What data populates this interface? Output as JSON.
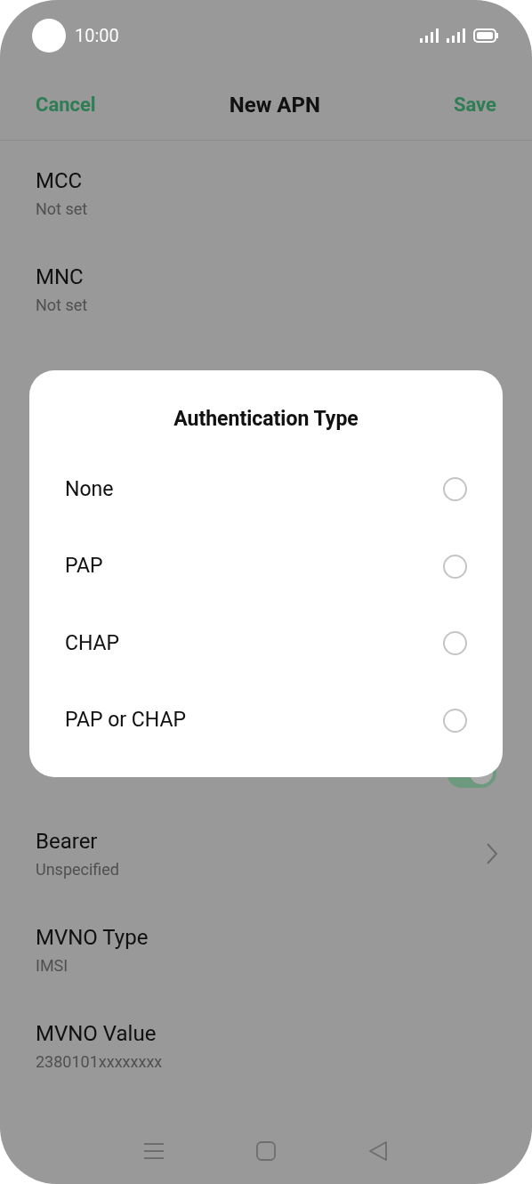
{
  "status_bar": {
    "time": "10:00"
  },
  "header": {
    "cancel": "Cancel",
    "title": "New APN",
    "save": "Save"
  },
  "fields_top": [
    {
      "label": "MCC",
      "value": "Not set"
    },
    {
      "label": "MNC",
      "value": "Not set"
    }
  ],
  "enable_toggle": {
    "on": true
  },
  "fields_bottom": [
    {
      "label": "Bearer",
      "value": "Unspecified",
      "chevron": true
    },
    {
      "label": "MVNO Type",
      "value": "IMSI",
      "chevron": false
    },
    {
      "label": "MVNO Value",
      "value": "2380101xxxxxxxx",
      "chevron": false
    }
  ],
  "dialog": {
    "title": "Authentication Type",
    "options": [
      {
        "label": "None",
        "selected": false
      },
      {
        "label": "PAP",
        "selected": false
      },
      {
        "label": "CHAP",
        "selected": false
      },
      {
        "label": "PAP or CHAP",
        "selected": false
      }
    ]
  }
}
